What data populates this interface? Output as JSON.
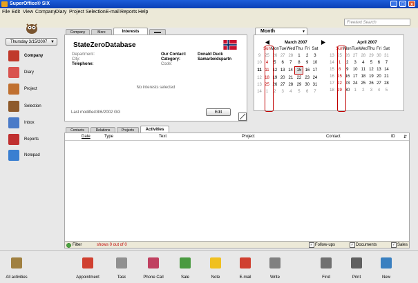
{
  "window": {
    "title": "SuperOffice® SIX",
    "min": "_",
    "max": "□",
    "close": "x"
  },
  "menu": [
    "File",
    "Edit",
    "View",
    "Company",
    "Diary",
    "Project",
    "Selection",
    "E-mail",
    "Reports",
    "Help"
  ],
  "search": {
    "placeholder": "Freetext Search"
  },
  "date_selector": {
    "value": "Thursday 3/15/2007",
    "arrow": "▼"
  },
  "nav": [
    {
      "label": "Company",
      "icon": "company-icon",
      "color": "#c0392b"
    },
    {
      "label": "Diary",
      "icon": "diary-icon",
      "color": "#d9534f"
    },
    {
      "label": "Project",
      "icon": "project-icon",
      "color": "#c07030"
    },
    {
      "label": "Selection",
      "icon": "selection-icon",
      "color": "#8e5a2b"
    },
    {
      "label": "Inbox",
      "icon": "inbox-icon",
      "color": "#4a7bc8"
    },
    {
      "label": "Reports",
      "icon": "reports-icon",
      "color": "#c03030"
    },
    {
      "label": "Notepad",
      "icon": "notepad-icon",
      "color": "#3a7fd1"
    }
  ],
  "card": {
    "tabs": [
      "Company",
      "More",
      "Interests",
      "▬▬"
    ],
    "company_name": "StateZeroDatabase",
    "fields_left": [
      {
        "label": "Department:",
        "value": ""
      },
      {
        "label": "City:",
        "value": ""
      },
      {
        "label": "Telephone:",
        "value": ""
      }
    ],
    "fields_right": [
      {
        "label": "Our Contact:",
        "value": "Donald Duck"
      },
      {
        "label": "Category:",
        "value": "Samarbeidspartn"
      },
      {
        "label": "Code:",
        "value": ""
      }
    ],
    "empty_message": "No interests selected",
    "last_modified_label": "Last modified:",
    "last_modified_value": "8/6/2002 GG",
    "edit_label": "Edit",
    "flag_colors": {
      "red": "#c8102e",
      "white": "#ffffff",
      "blue": "#002868"
    }
  },
  "calendar": {
    "mode": "Month",
    "mode_arrow": "▼",
    "months": [
      {
        "title": "March 2007",
        "weekdays": [
          "Sun",
          "Mon",
          "Tue",
          "Wed",
          "Thu",
          "Fri",
          "Sat"
        ],
        "weeks": [
          [
            "25",
            "26",
            "27",
            "28",
            "1",
            "2",
            "3"
          ],
          [
            "4",
            "5",
            "6",
            "7",
            "8",
            "9",
            "10"
          ],
          [
            "11",
            "12",
            "13",
            "14",
            "15",
            "16",
            "17"
          ],
          [
            "18",
            "19",
            "20",
            "21",
            "22",
            "23",
            "24"
          ],
          [
            "25",
            "26",
            "27",
            "28",
            "29",
            "30",
            "31"
          ],
          [
            "1",
            "2",
            "3",
            "4",
            "5",
            "6",
            "7"
          ]
        ],
        "week_numbers": [
          "9",
          "10",
          "11",
          "12",
          "13",
          "14"
        ],
        "today": "15"
      },
      {
        "title": "April 2007",
        "weekdays": [
          "Sun",
          "Mon",
          "Tue",
          "Wed",
          "Thu",
          "Fri",
          "Sat"
        ],
        "weeks": [
          [
            "25",
            "26",
            "27",
            "28",
            "29",
            "30",
            "31"
          ],
          [
            "1",
            "2",
            "3",
            "4",
            "5",
            "6",
            "7"
          ],
          [
            "8",
            "9",
            "10",
            "11",
            "12",
            "13",
            "14"
          ],
          [
            "15",
            "16",
            "17",
            "18",
            "19",
            "20",
            "21"
          ],
          [
            "22",
            "23",
            "24",
            "25",
            "26",
            "27",
            "28"
          ],
          [
            "29",
            "30",
            "1",
            "2",
            "3",
            "4",
            "5"
          ]
        ],
        "week_numbers": [
          "13",
          "14",
          "15",
          "16",
          "17",
          "18"
        ]
      }
    ]
  },
  "activities": {
    "tabs": [
      "Contacts",
      "Relations",
      "Projects",
      "Activities"
    ],
    "columns": [
      "Date",
      "Type",
      "Text",
      "Project",
      "Contact",
      "ID"
    ],
    "filter_label": "Filter",
    "count_text": "shows 0 out of 0",
    "checkboxes": [
      {
        "label": "Follow-ups",
        "checked": true
      },
      {
        "label": "Documents",
        "checked": true
      },
      {
        "label": "Sales",
        "checked": true
      }
    ]
  },
  "bottom_toolbar": [
    {
      "label": "All activities",
      "icon": "all-activities-icon",
      "color": "#a08040"
    },
    {
      "label": "Appointment",
      "icon": "appointment-icon",
      "color": "#d04030"
    },
    {
      "label": "Task",
      "icon": "task-icon",
      "color": "#909090"
    },
    {
      "label": "Phone Call",
      "icon": "phone-call-icon",
      "color": "#c04060"
    },
    {
      "label": "Sale",
      "icon": "sale-icon",
      "color": "#4a9a40"
    },
    {
      "label": "Note",
      "icon": "note-icon",
      "color": "#f0c020"
    },
    {
      "label": "E-mail",
      "icon": "email-icon",
      "color": "#d04030"
    },
    {
      "label": "Write",
      "icon": "write-icon",
      "color": "#808080"
    },
    {
      "label": "Find",
      "icon": "find-icon",
      "color": "#707070"
    },
    {
      "label": "Print",
      "icon": "print-icon",
      "color": "#606060"
    },
    {
      "label": "New",
      "icon": "new-icon",
      "color": "#3a80c0"
    }
  ]
}
